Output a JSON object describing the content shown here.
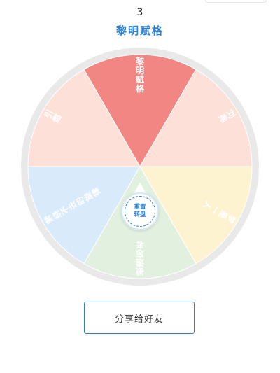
{
  "header": {
    "spin_count": "3",
    "result_text": "黎明赋格"
  },
  "wheel": {
    "segments": [
      {
        "label": "黎明赋格",
        "color": "#f28683",
        "selected": true
      },
      {
        "label": "刘弗",
        "color": "#fde1d8",
        "selected": false
      },
      {
        "label": "梦是一人",
        "color": "#fef3d0",
        "selected": false
      },
      {
        "label": "被遗忘者",
        "color": "#e2f0df",
        "selected": false
      },
      {
        "label": "萦绕不去的旋律",
        "color": "#d9eafb",
        "selected": false
      },
      {
        "label": "引燃",
        "color": "#fde1d8",
        "selected": false
      }
    ],
    "rim_color": "#e9e9e9",
    "accent_color": "#2a7fd0"
  },
  "center_button": {
    "line1": "重置",
    "line2": "转盘"
  },
  "share_button": {
    "label": "分享给好友"
  }
}
